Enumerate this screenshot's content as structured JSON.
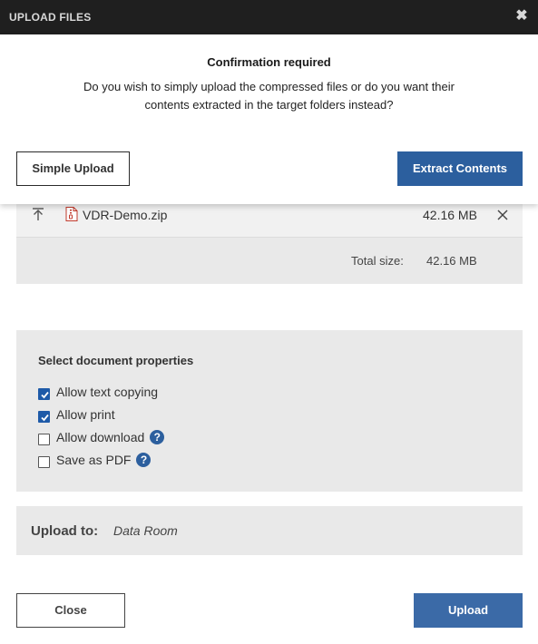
{
  "window": {
    "title": "UPLOAD FILES",
    "close_glyph": "✖"
  },
  "confirm": {
    "heading": "Confirmation required",
    "message": "Do you wish to simply upload the compressed files or do you want their contents extracted in the target folders instead?",
    "simple_upload_label": "Simple Upload",
    "extract_label": "Extract Contents"
  },
  "files": {
    "items": [
      {
        "name": "VDR-Demo.zip",
        "size": "42.16 MB"
      }
    ],
    "total_label": "Total size:",
    "total_value": "42.16 MB"
  },
  "properties": {
    "heading": "Select document properties",
    "options": [
      {
        "label": "Allow text copying",
        "checked": true,
        "help": false
      },
      {
        "label": "Allow print",
        "checked": true,
        "help": false
      },
      {
        "label": "Allow download",
        "checked": false,
        "help": true
      },
      {
        "label": "Save as PDF",
        "checked": false,
        "help": true
      }
    ],
    "help_glyph": "?"
  },
  "upload_to": {
    "label": "Upload to:",
    "value": "Data Room"
  },
  "footer": {
    "close_label": "Close",
    "upload_label": "Upload"
  },
  "colors": {
    "primary": "#2c5f9e",
    "panel": "#e9e9e9",
    "titlebar": "#1f1f1f",
    "zip_icon": "#c0392b"
  }
}
